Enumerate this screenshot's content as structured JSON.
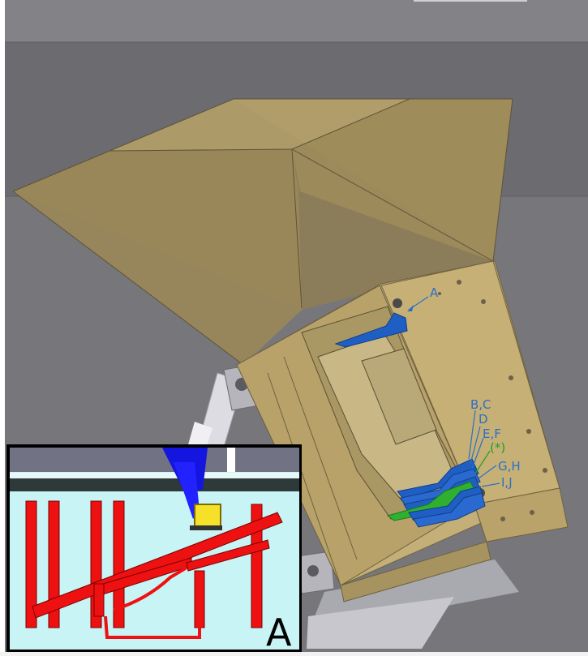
{
  "labels": {
    "a": "A",
    "bc": "B,C",
    "d": "D",
    "ef": "E,F",
    "star": "(*)",
    "gh": "G,H",
    "ij": "I,J"
  },
  "inset": {
    "label": "A"
  },
  "colors": {
    "background_upper": "#7d7d80",
    "background_lower": "#6e6e72",
    "horn": "#a18f5e",
    "enclosure": "#c0a86c",
    "blue_parts": "#1f5fc4",
    "green_part": "#2fb030",
    "label_blue": "#2b6fc8",
    "label_green": "#22a022",
    "inset_bg": "#c9f4f6",
    "inset_red": "#ee1111",
    "inset_yellow": "#f5e12a"
  }
}
